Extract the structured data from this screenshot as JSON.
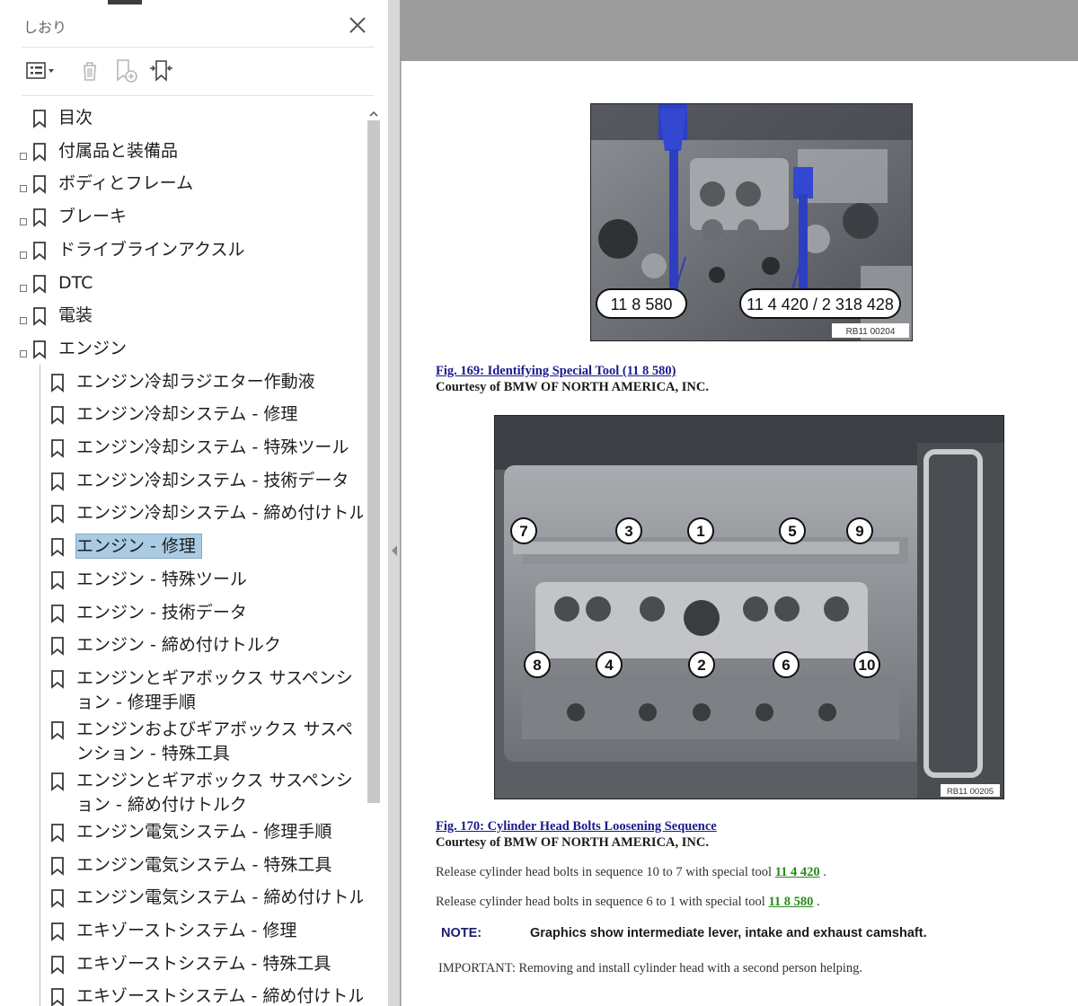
{
  "bookmarks_panel": {
    "title": "しおり",
    "items": [
      {
        "label": "目次",
        "level": 0,
        "expandable": false
      },
      {
        "label": "付属品と装備品",
        "level": 0,
        "expandable": true
      },
      {
        "label": "ボディとフレーム",
        "level": 0,
        "expandable": true
      },
      {
        "label": "ブレーキ",
        "level": 0,
        "expandable": true
      },
      {
        "label": "ドライブラインアクスル",
        "level": 0,
        "expandable": true
      },
      {
        "label": "DTC",
        "level": 0,
        "expandable": true
      },
      {
        "label": "電装",
        "level": 0,
        "expandable": true
      },
      {
        "label": "エンジン",
        "level": 0,
        "expandable": true
      },
      {
        "label": "エンジン冷却ラジエター作動液",
        "level": 1
      },
      {
        "label": "エンジン冷却システム - 修理",
        "level": 1
      },
      {
        "label": "エンジン冷却システム - 特殊ツール",
        "level": 1
      },
      {
        "label": "エンジン冷却システム - 技術データ",
        "level": 1
      },
      {
        "label": "エンジン冷却システム - 締め付けトルク",
        "level": 1
      },
      {
        "label": "エンジン - 修理",
        "level": 1,
        "selected": true
      },
      {
        "label": "エンジン - 特殊ツール",
        "level": 1
      },
      {
        "label": "エンジン - 技術データ",
        "level": 1
      },
      {
        "label": "エンジン - 締め付けトルク",
        "level": 1
      },
      {
        "label": "エンジンとギアボックス サスペンション - 修理手順",
        "level": 1,
        "lines": 2
      },
      {
        "label": "エンジンおよびギアボックス サスペンション - 特殊工具",
        "level": 1,
        "lines": 2
      },
      {
        "label": "エンジンとギアボックス サスペンション - 締め付けトルク",
        "level": 1,
        "lines": 2
      },
      {
        "label": "エンジン電気システム - 修理手順",
        "level": 1
      },
      {
        "label": "エンジン電気システム - 特殊工具",
        "level": 1
      },
      {
        "label": "エンジン電気システム - 締め付けトルク",
        "level": 1
      },
      {
        "label": "エキゾーストシステム - 修理",
        "level": 1
      },
      {
        "label": "エキゾーストシステム - 特殊工具",
        "level": 1
      },
      {
        "label": "エキゾーストシステム - 締め付けトルク",
        "level": 1
      }
    ]
  },
  "document": {
    "fig169": {
      "tool_label_left": "11 8 580",
      "tool_label_right": "11 4 420 / 2 318 428",
      "code": "RB11 00204",
      "caption": "Fig. 169: Identifying Special Tool (11 8 580)",
      "courtesy": "Courtesy of BMW OF NORTH AMERICA, INC."
    },
    "fig170": {
      "bolt_numbers_top": [
        "7",
        "3",
        "1",
        "5",
        "9"
      ],
      "bolt_numbers_bottom": [
        "8",
        "4",
        "2",
        "6",
        "10"
      ],
      "code": "RB11 00205",
      "caption": "Fig. 170: Cylinder Head Bolts Loosening Sequence",
      "courtesy": "Courtesy of BMW OF NORTH AMERICA, INC."
    },
    "para1_text": "Release cylinder head bolts in sequence 10 to 7 with special tool",
    "para1_link": "11 4 420",
    "para1_end": ".",
    "para2_text": "Release cylinder head bolts in sequence 6 to 1 with special tool",
    "para2_link": "11 8 580",
    "para2_end": ".",
    "note_label": "NOTE:",
    "note_text": "Graphics show intermediate lever, intake and exhaust camshaft.",
    "important": "IMPORTANT: Removing and install cylinder head with a second person helping."
  },
  "colors": {
    "selection": "#a9cbe4",
    "link_green": "#2a8a1e",
    "caption_blue": "#1a1a8c",
    "tool_blue": "#2d3fc0"
  }
}
